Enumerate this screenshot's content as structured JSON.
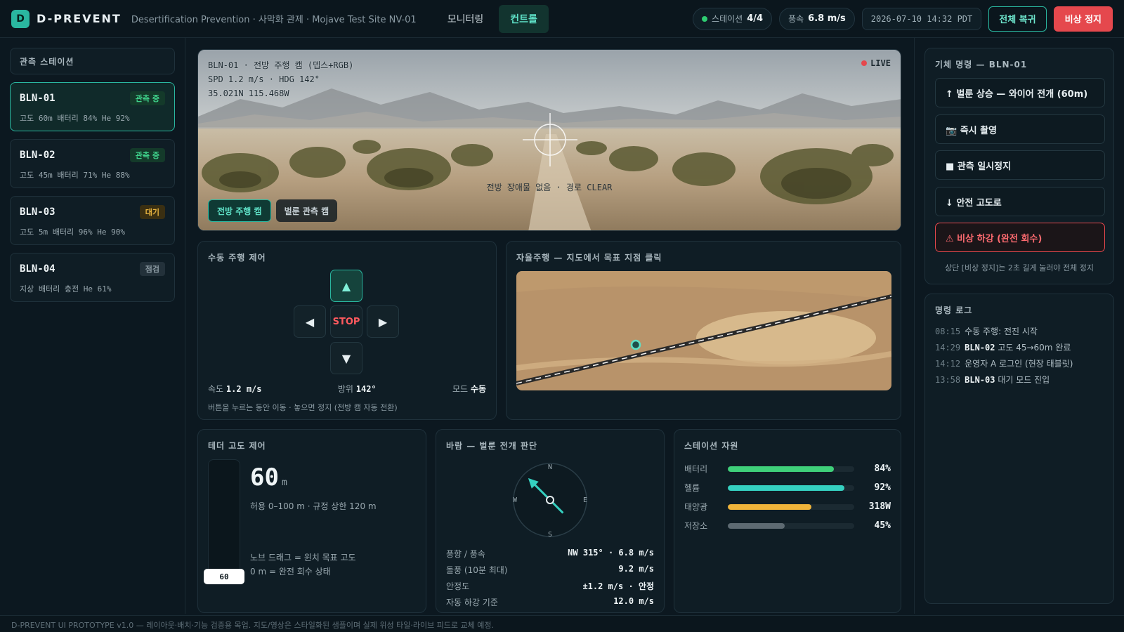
{
  "header": {
    "logo_letter": "D",
    "brand": "D-PREVENT",
    "subtitle": "Desertification Prevention · 사막화 관제 · Mojave Test Site NV-01",
    "tabs": [
      {
        "label": "모니터링",
        "active": false
      },
      {
        "label": "컨트롤",
        "active": true
      }
    ],
    "station_label": "스테이션",
    "station_value": "4/4",
    "wind_label": "풍속",
    "wind_value": "6.8 m/s",
    "clock": "2026-07-10 14:32 PDT",
    "restore_all": "전체 복귀",
    "emergency_stop": "비상 정지"
  },
  "stations": {
    "title": "관측 스테이션",
    "items": [
      {
        "name": "BLN-01",
        "status": "관측 중",
        "status_color": "green",
        "meta": "고도 60m  배터리 84%  He 92%"
      },
      {
        "name": "BLN-02",
        "status": "관측 중",
        "status_color": "green",
        "meta": "고도 45m  배터리 71%  He 88%"
      },
      {
        "name": "BLN-03",
        "status": "대기",
        "status_color": "amber",
        "meta": "고도 5m  배터리 96%  He 90%"
      },
      {
        "name": "BLN-04",
        "status": "점검",
        "status_color": "gray",
        "meta": "지상  배터리 충전  He 61%"
      }
    ]
  },
  "camera": {
    "line1": "BLN-01 · 전방 주행 캠 (뎁스+RGB)",
    "line2": "SPD 1.2 m/s · HDG 142°",
    "line3": "35.021N 115.468W",
    "live": "LIVE",
    "status": "전방 장애물 없음 · 경로 CLEAR",
    "tabs": [
      "전방 주행 캠",
      "벌룬 관측 캠"
    ]
  },
  "manual": {
    "title": "수동 주행 제어",
    "up": "▲",
    "left": "◀",
    "stop": "STOP",
    "right": "▶",
    "down": "▼",
    "speed_label": "속도",
    "speed_value": "1.2 m/s",
    "heading_label": "방위",
    "heading_value": "142°",
    "mode_label": "모드",
    "mode_value": "수동",
    "hint": "버튼을 누르는 동안 이동 · 놓으면 정지 (전방 캠 자동 전환)"
  },
  "auto": {
    "title": "자율주행 — 지도에서 목표 지점 클릭"
  },
  "tether": {
    "title": "테더 고도 제어",
    "value": "60",
    "unit": "m",
    "knob": "60",
    "range": "허용 0–100 m · 규정 상한 120 m",
    "hint1": "노브 드래그 = 윈치 목표 고도",
    "hint2": "0 m = 완전 회수 상태",
    "max_m": 100
  },
  "wind": {
    "title": "바람 — 벌룬 전개 판단",
    "compass": {
      "n": "N",
      "e": "E",
      "s": "S",
      "w": "W"
    },
    "rows": [
      {
        "label": "풍향 / 풍속",
        "value": "NW 315° · 6.8 m/s"
      },
      {
        "label": "돌풍 (10분 최대)",
        "value": "9.2 m/s"
      },
      {
        "label": "안정도",
        "value": "±1.2 m/s · 안정"
      },
      {
        "label": "자동 하강 기준",
        "value": "12.0 m/s"
      }
    ],
    "direction_deg": 315
  },
  "resources": {
    "title": "스테이션 자원",
    "rows": [
      {
        "label": "배터리",
        "value": "84%",
        "fill": 0.84,
        "color": "#3fd07a"
      },
      {
        "label": "헬륨",
        "value": "92%",
        "fill": 0.92,
        "color": "#35d0c0"
      },
      {
        "label": "태양광",
        "value": "318W",
        "fill": 0.66,
        "color": "#f0b43a"
      },
      {
        "label": "저장소",
        "value": "45%",
        "fill": 0.45,
        "color": "#5d6a72"
      }
    ]
  },
  "commands": {
    "title": "기체 명령 — BLN-01",
    "items": [
      {
        "label": "↑ 벌룬 상승 — 와이어 전개 (60m)",
        "danger": false
      },
      {
        "label": "📷 즉시 촬영",
        "danger": false
      },
      {
        "label": "■ 관측 일시정지",
        "danger": false
      },
      {
        "label": "↓ 안전 고도로",
        "danger": false
      },
      {
        "label": "⚠ 비상 하강 (완전 회수)",
        "danger": true
      }
    ],
    "note": "상단 [비상 정지]는 2초 길게 눌러야 전체 정지"
  },
  "log": {
    "title": "명령 로그",
    "items": [
      {
        "time": "08:15",
        "station": "",
        "text": "수동 주행: 전진 시작"
      },
      {
        "time": "14:29",
        "station": "BLN-02",
        "text": "고도 45→60m 완료"
      },
      {
        "time": "14:12",
        "station": "",
        "text": "운영자 A 로그인 (현장 태블릿)"
      },
      {
        "time": "13:58",
        "station": "BLN-03",
        "text": "대기 모드 진입"
      }
    ]
  },
  "footer": "D-PREVENT UI PROTOTYPE v1.0 — 레이아웃·배치·기능 검증용 목업. 지도/영상은 스타일화된 샘플이며 실제 위성 타일·라이브 피드로 교체 예정.",
  "colors": {
    "accent": "#2ab7a0",
    "danger": "#e5484d",
    "background": "#0c1820"
  }
}
